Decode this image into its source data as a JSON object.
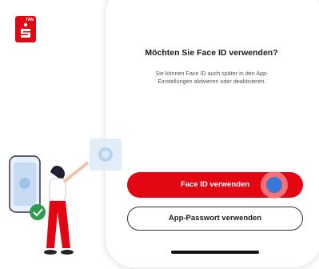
{
  "logo": {
    "badge": "TAN",
    "icon": "sparkasse-s-icon",
    "color": "#e30613"
  },
  "dialog": {
    "title": "Möchten Sie Face ID verwenden?",
    "description_line1": "Sie können Face ID  auch später in den App-",
    "description_line2": "Einstellungen aktivieren oder deaktivieren."
  },
  "buttons": {
    "primary_label": "Face ID verwenden",
    "secondary_label": "App-Passwort verwenden"
  },
  "colors": {
    "accent": "#e30613",
    "touch": "#3b77d9"
  }
}
